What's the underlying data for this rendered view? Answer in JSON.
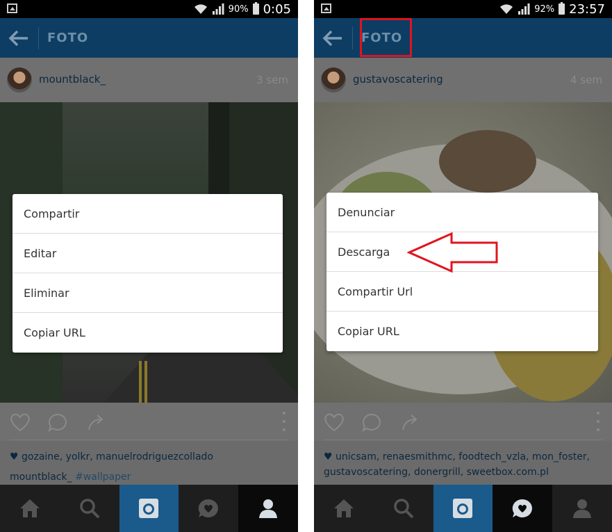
{
  "left": {
    "status": {
      "battery": "90%",
      "time": "0:05"
    },
    "appbar": {
      "title": "FOTO"
    },
    "post": {
      "username": "mountblack_",
      "ago": "3 sem",
      "likes": "gozaine, yolkr, manuelrodriguezcollado",
      "caption_user": "mountblack_",
      "caption_tag": "#wallpaper"
    },
    "menu": {
      "items": [
        "Compartir",
        "Editar",
        "Eliminar",
        "Copiar URL"
      ]
    }
  },
  "right": {
    "status": {
      "battery": "92%",
      "time": "23:57"
    },
    "appbar": {
      "title": "FOTO"
    },
    "post": {
      "username": "gustavoscatering",
      "ago": "4 sem",
      "likes_line1": "unicsam, renaesmithmc, foodtech_vzla, mon_foster,",
      "likes_line2": "gustavoscatering, donergrill, sweetbox.com.pl"
    },
    "menu": {
      "items": [
        "Denunciar",
        "Descarga",
        "Compartir Url",
        "Copiar URL"
      ]
    }
  },
  "icons": [
    "back-arrow-icon",
    "heart-icon",
    "comment-icon",
    "share-icon",
    "more-vert-icon",
    "home-icon",
    "search-icon",
    "camera-icon",
    "activity-icon",
    "profile-icon"
  ],
  "colors": {
    "appbar": "#0d3d63",
    "annotation_red": "#e0141e",
    "active_tab": "#1a5b8c"
  }
}
